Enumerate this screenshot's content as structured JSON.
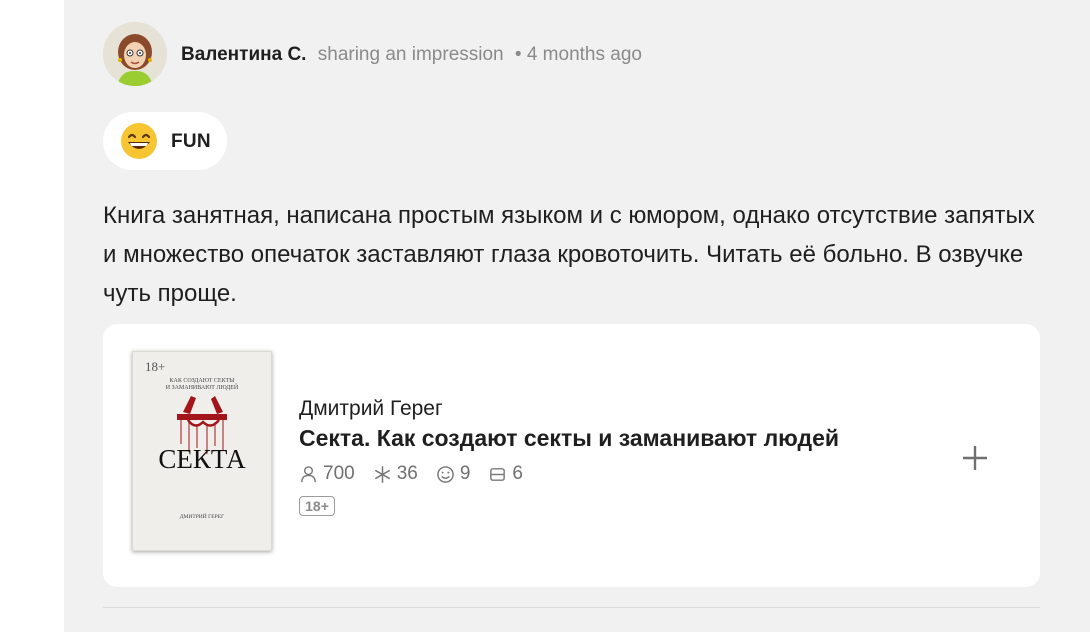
{
  "review": {
    "author_name": "Валентина С.",
    "action_text": "sharing an impression",
    "time_text": "• 4 months ago",
    "emotion": {
      "label": "FUN",
      "icon": "grinning-face-icon"
    },
    "text": "Книга занятная, написана простым языком и с юмором, однако отсутствие запятых и множество опечаток заставляют глаза кровоточить. Читать её больно. В озвучке чуть проще."
  },
  "book": {
    "author": "Дмитрий Герег",
    "title": "Секта. Как создают секты и заманивают людей",
    "stats": {
      "readers": "700",
      "quotes": "36",
      "impressions": "9",
      "shelves": "6"
    },
    "age_rating": "18+",
    "cover": {
      "age": "18+",
      "subtitle_line1": "КАК СОЗДАЮТ СЕКТЫ",
      "subtitle_line2": "И ЗАМАНИВАЮТ ЛЮДЕЙ",
      "title": "СЕКТА",
      "author": "ДМИТРИЙ ГЕРЕГ"
    }
  },
  "colors": {
    "panel_bg": "#f1f1f1",
    "card_bg": "#ffffff",
    "muted_text": "#8a8a8a",
    "cover_red": "#a3151a"
  }
}
